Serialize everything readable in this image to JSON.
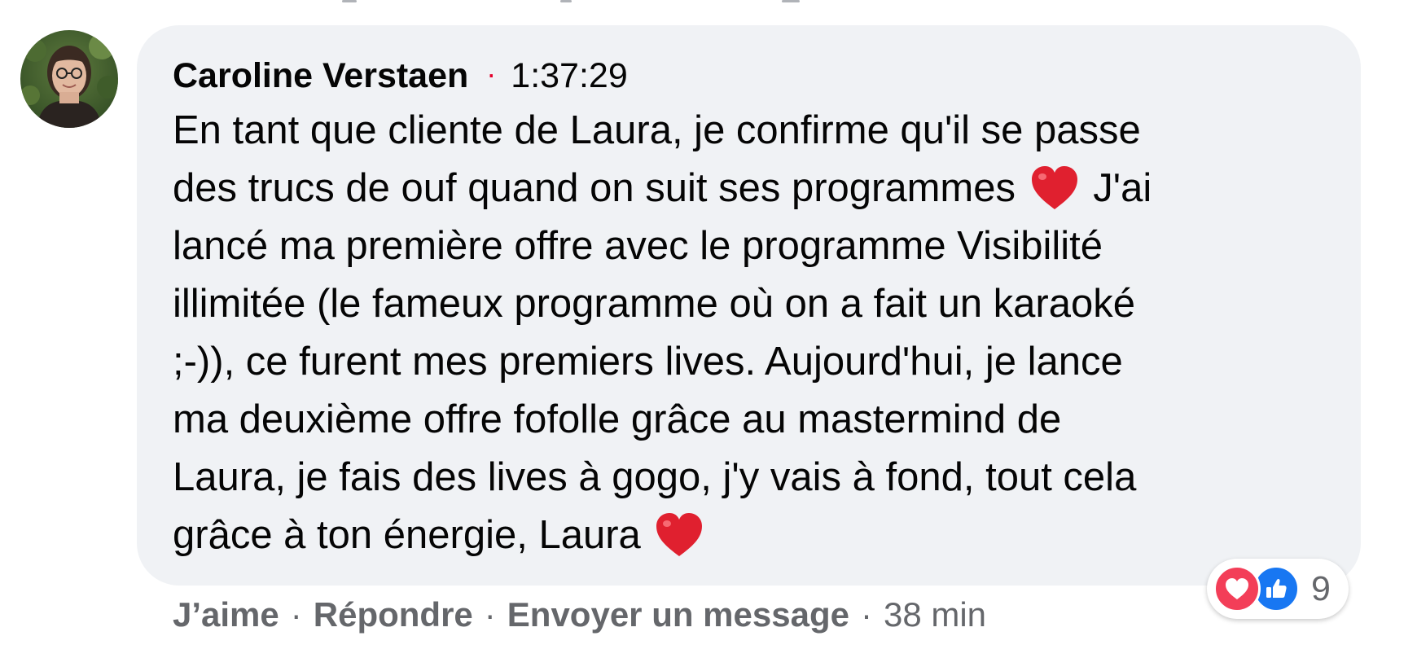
{
  "comment": {
    "author": "Caroline Verstaen",
    "separator_dot": "·",
    "timecode": "1:37:29",
    "text_lines": [
      "En tant que cliente de Laura, je confirme qu'il se passe",
      "des trucs de ouf quand on suit ses programmes",
      "J'ai",
      "lancé ma première offre avec le programme Visibilité",
      "illimitée (le fameux programme où on a fait un karaoké",
      ";-)), ce furent mes premiers lives. Aujourd'hui, je lance",
      "ma deuxième offre fofolle grâce au mastermind de",
      "Laura, je fais des lives à gogo, j'y vais à fond, tout cela",
      "grâce à ton énergie, Laura"
    ],
    "emoji_inline": "heart-emoji"
  },
  "actions": {
    "like_label": "J’aime",
    "reply_label": "Répondre",
    "message_label": "Envoyer un message",
    "separator": "·",
    "time_ago": "38 min"
  },
  "reactions": {
    "icons": [
      "heart-reaction-icon",
      "thumbs-up-reaction-icon"
    ],
    "count": "9"
  },
  "colors": {
    "bubble_bg": "#f0f2f5",
    "text": "#050505",
    "secondary_text": "#65676b",
    "love": "#f33e58",
    "like": "#1877f2",
    "dot": "#e4002b"
  }
}
